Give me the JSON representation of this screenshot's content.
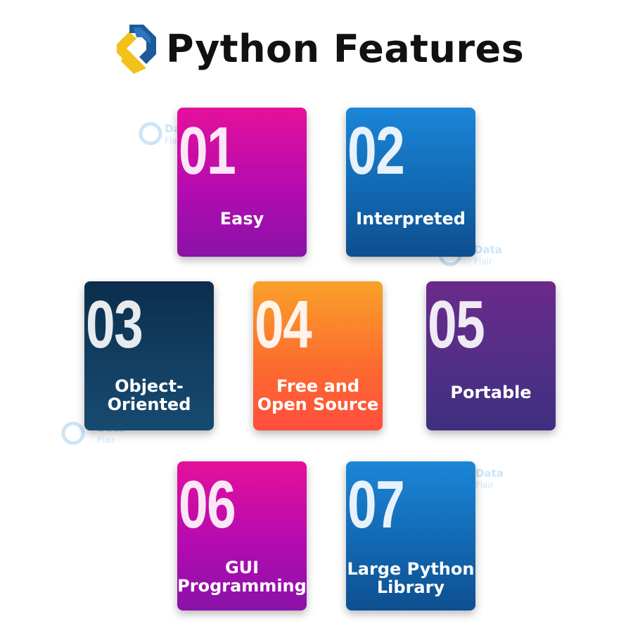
{
  "header": {
    "title": "Python Features"
  },
  "features": [
    {
      "number": "01",
      "label": "Easy"
    },
    {
      "number": "02",
      "label": "Interpreted"
    },
    {
      "number": "03",
      "label": "Object-\nOriented"
    },
    {
      "number": "04",
      "label": "Free and\nOpen Source"
    },
    {
      "number": "05",
      "label": "Portable"
    },
    {
      "number": "06",
      "label": "GUI\nProgramming"
    },
    {
      "number": "07",
      "label": "Large Python\nLibrary"
    }
  ],
  "watermark": {
    "line1": "Data",
    "line2": "Flair"
  },
  "colors": {
    "pink": "#e5109a",
    "blue": "#1b86d8",
    "navy": "#0b2e4c",
    "orange": "#fc6d2f",
    "purple": "#512f87",
    "logo_blue": "#1c5a9c",
    "logo_yellow": "#f2c21b"
  }
}
